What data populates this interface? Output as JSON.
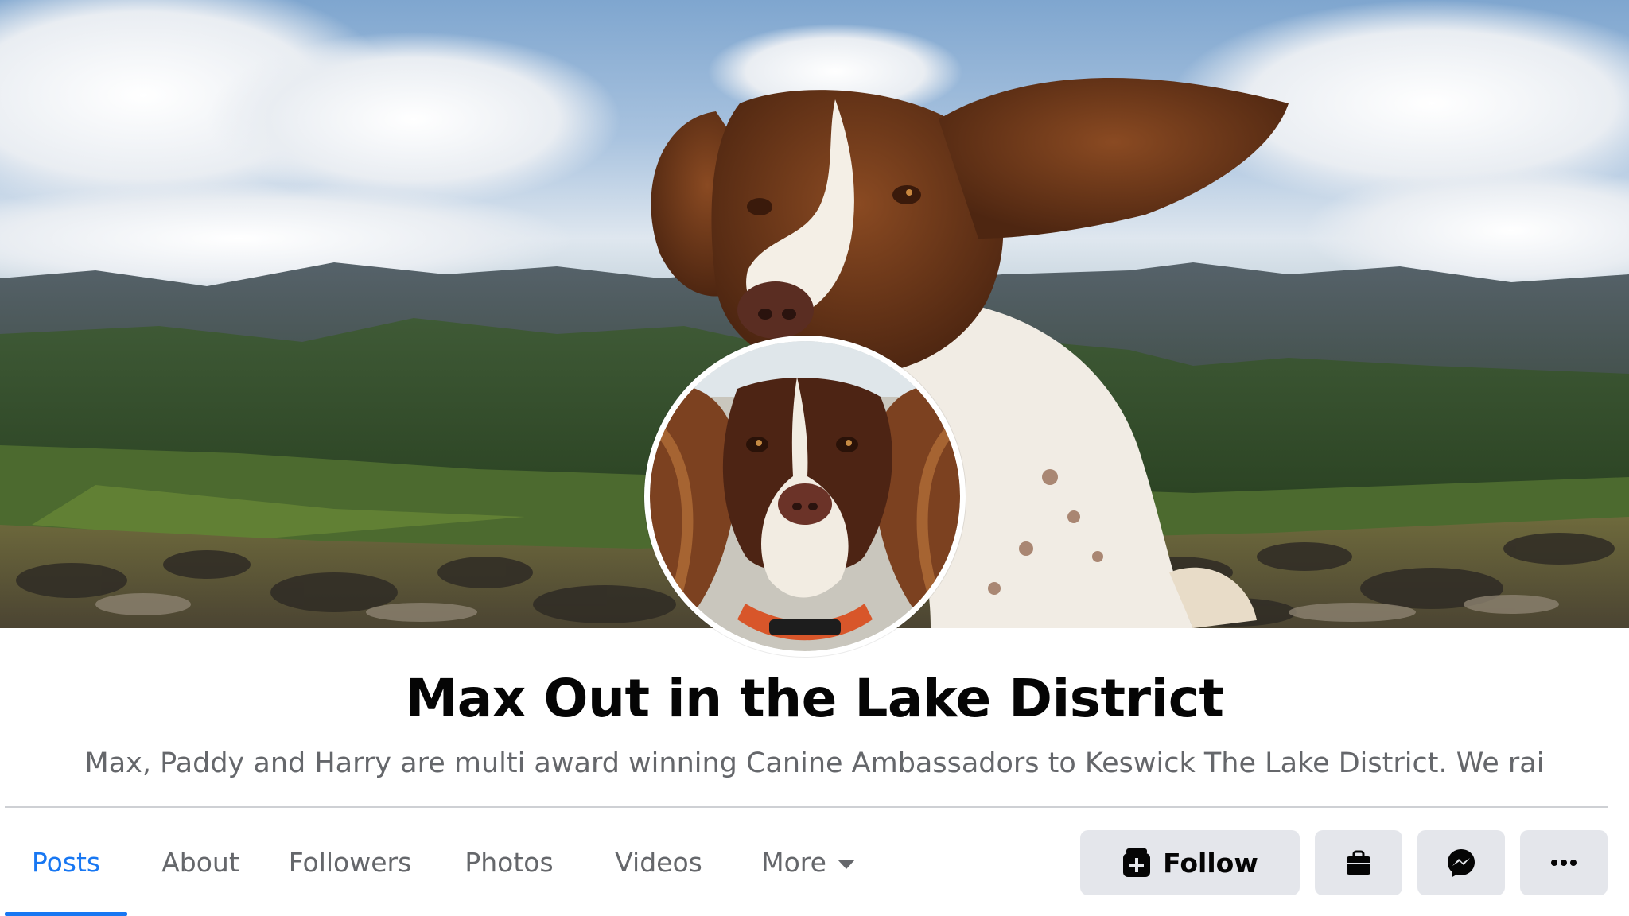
{
  "page": {
    "title": "Max Out in the Lake District",
    "bio": "Max, Paddy and Harry are multi award winning Canine Ambassadors to Keswick The Lake District. We rai"
  },
  "tabs": [
    {
      "label": "Posts",
      "active": true
    },
    {
      "label": "About",
      "active": false
    },
    {
      "label": "Followers",
      "active": false
    },
    {
      "label": "Photos",
      "active": false
    },
    {
      "label": "Videos",
      "active": false
    },
    {
      "label": "More",
      "active": false,
      "icon": "caret-down-icon"
    }
  ],
  "actions": {
    "follow_label": "Follow",
    "follow_icon": "follow-plus-icon",
    "shop_icon": "shopping-bag-icon",
    "message_icon": "messenger-icon",
    "more_icon": "more-options-icon"
  },
  "colors": {
    "accent": "#1877f2",
    "button_bg": "#e4e6eb",
    "secondary_text": "#65676b",
    "primary_text": "#050505"
  }
}
